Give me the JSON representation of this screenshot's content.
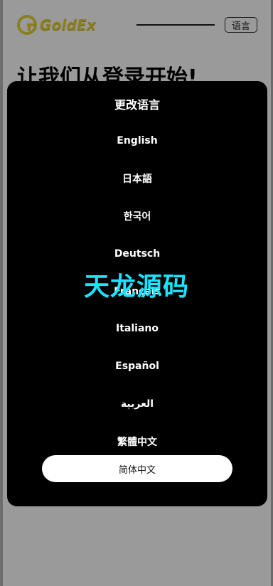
{
  "header": {
    "logo_text": "GoldEx",
    "language_button": "语言"
  },
  "page": {
    "heading": "让我们从登录开始!"
  },
  "modal": {
    "title": "更改语言",
    "options": [
      "English",
      "日本語",
      "한국어",
      "Deutsch",
      "Français",
      "Italiano",
      "Español",
      "العربية",
      "繁體中文"
    ],
    "selected_label": "简体中文"
  },
  "watermark": "天龙源码",
  "colors": {
    "overlay": "#9a9a9a",
    "modal": "#000000",
    "watermark": "#18e4ff",
    "logo_gold": "#8a7f1f"
  }
}
